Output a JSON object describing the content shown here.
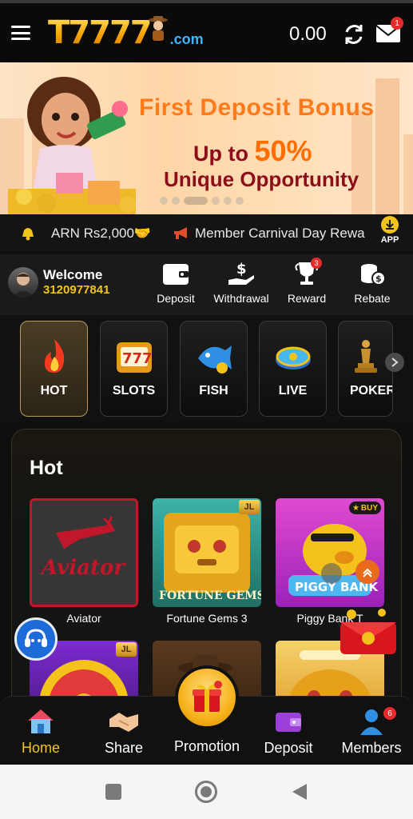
{
  "header": {
    "logo_text": "T7777",
    "logo_suffix": ".com",
    "balance": "0.00",
    "mail_badge": "1"
  },
  "banner": {
    "title": "First Deposit Bonus",
    "line2_prefix": "Up to ",
    "line2_percent": "50%",
    "line3": "Unique Opportunity",
    "active_slide": 3,
    "slide_count": 7
  },
  "marquee": {
    "text1": "ARN Rs2,000🤝",
    "text2": "Member Carnival Day Rewa",
    "app_label": "APP"
  },
  "user": {
    "welcome": "Welcome",
    "id": "3120977841"
  },
  "actions": {
    "deposit": "Deposit",
    "withdrawal": "Withdrawal",
    "reward": "Reward",
    "reward_badge": "3",
    "rebate": "Rebate"
  },
  "categories": [
    "HOT",
    "SLOTS",
    "FISH",
    "LIVE",
    "POKER"
  ],
  "hot": {
    "title": "Hot",
    "games": [
      {
        "name": "Aviator",
        "art": "Aviator"
      },
      {
        "name": "Fortune Gems 3",
        "art": "FORTUNE GEMS 3"
      },
      {
        "name": "Piggy Bank T",
        "art": "PIGGY BANK"
      }
    ],
    "jl_badge": "JL",
    "buy_badge": "BUY"
  },
  "bottom_nav": {
    "home": "Home",
    "share": "Share",
    "promotion": "Promotion",
    "deposit": "Deposit",
    "members": "Members",
    "members_badge": "6"
  },
  "colors": {
    "accent": "#f2c417",
    "background": "#0f0f0f",
    "banner_orange": "#ff7a1a",
    "banner_red": "#8b0e1a"
  }
}
